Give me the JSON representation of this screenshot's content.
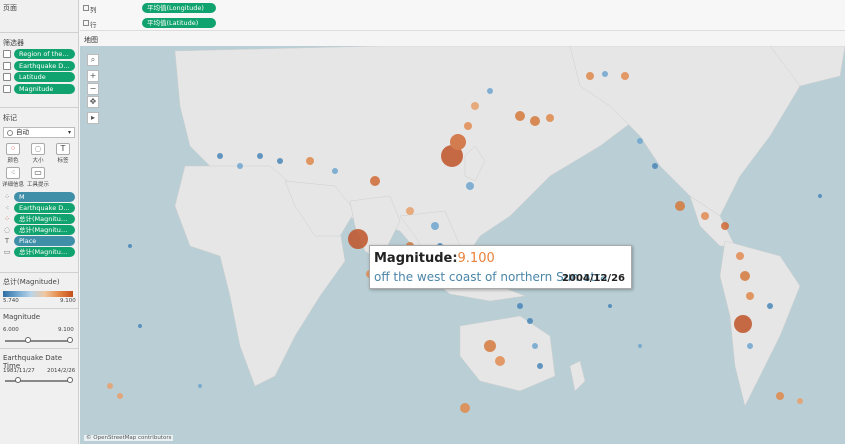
{
  "left": {
    "pages_title": "页面",
    "filters_title": "筛选器",
    "filters": [
      "Region of the W...",
      "Earthquake Date...",
      "Latitude",
      "Magnitude"
    ],
    "marks_title": "标记",
    "mark_type": "自动",
    "mark_buttons": [
      "颜色",
      "大小",
      "标签",
      "详细信息",
      "工具提示"
    ],
    "mark_rows": [
      {
        "icon": "dots-icon",
        "label": "M"
      },
      {
        "icon": "detail-icon",
        "label": "Earthquake Da..."
      },
      {
        "icon": "color-icon",
        "label": "总计(Magnitud..."
      },
      {
        "icon": "size-icon",
        "label": "总计(Magnitud..."
      },
      {
        "icon": "label-icon",
        "label": "Place"
      },
      {
        "icon": "tooltip-icon",
        "label": "总计(Magnitud..."
      }
    ],
    "color_legend_title": "总计(Magnitude)",
    "color_min": "5.740",
    "color_max": "9.100",
    "mag_title": "Magnitude",
    "mag_min": "6.000",
    "mag_max": "9.100",
    "date_title": "Earthquake Date Time",
    "date_min": "1981/11/27",
    "date_max": "2014/2/26"
  },
  "shelves": {
    "columns_label": "列",
    "columns_pill": "平均值(Longitude)",
    "rows_label": "行",
    "rows_pill": "平均值(Latitude)"
  },
  "map": {
    "sheet_title": "地图",
    "attribution": "© OpenStreetMap contributors"
  },
  "tooltip": {
    "key": "Magnitude",
    "value": "9.100",
    "place": "off the west coast of northern Sumatra",
    "date": "2004/12/26"
  },
  "colors": {
    "low": "#2f6da3",
    "high": "#c44f1c",
    "pill_green": "#11a36f",
    "water": "#b9cfd5",
    "land": "#e6e6e6"
  }
}
